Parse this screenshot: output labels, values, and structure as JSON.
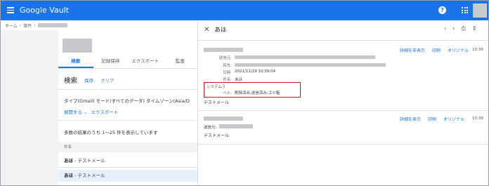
{
  "app": {
    "title": "Google Vault"
  },
  "header": {
    "help_icon": "help-circle-icon",
    "apps_icon": "apps-grid-icon"
  },
  "breadcrumb": {
    "home": "ホーム",
    "matters": "案件"
  },
  "left": {
    "tabs": [
      {
        "label": "検索"
      },
      {
        "label": "記録保持"
      },
      {
        "label": "エクスポート"
      },
      {
        "label": "監査"
      }
    ],
    "search_title": "検索",
    "save_label": "保存",
    "clear_label": "クリア",
    "type_line": "タイプ(Gmail) モード(すべてのデータ) タイムゾーン(Asia/D",
    "expand_label": "展開する",
    "export_label": "エクスポート",
    "results_text": "多数の結果のうち 1～25 件を表示しています",
    "column_subject": "件名",
    "rows": [
      {
        "sender": "あほ",
        "rest": " - テストメール"
      },
      {
        "sender": "あほ",
        "rest": " - テストメール"
      }
    ]
  },
  "right": {
    "title": "あほ",
    "messages": [
      {
        "hide_details": "詳細を非表示",
        "print": "印刷",
        "original": "オリジナル",
        "time": "10:39",
        "to_label": "送信元:",
        "from_label": "宛先:",
        "date_label": "日時:",
        "date_value": "2021/11/29 10:39:04",
        "subject_label": "件名:",
        "subject_value": "あほ",
        "system_label_a": "システムラ",
        "system_label_b": "ベル:",
        "system_value": "削除済み,送信済み,ゴミ箱",
        "body": "テストメール"
      },
      {
        "show_details": "詳細を表示",
        "print": "印刷",
        "original": "オリジナル",
        "time": "10:39",
        "to_label": "送信元:",
        "body": "テストメール"
      }
    ]
  },
  "colors": {
    "brand": "#1a73e8",
    "highlight": "#d01620"
  }
}
